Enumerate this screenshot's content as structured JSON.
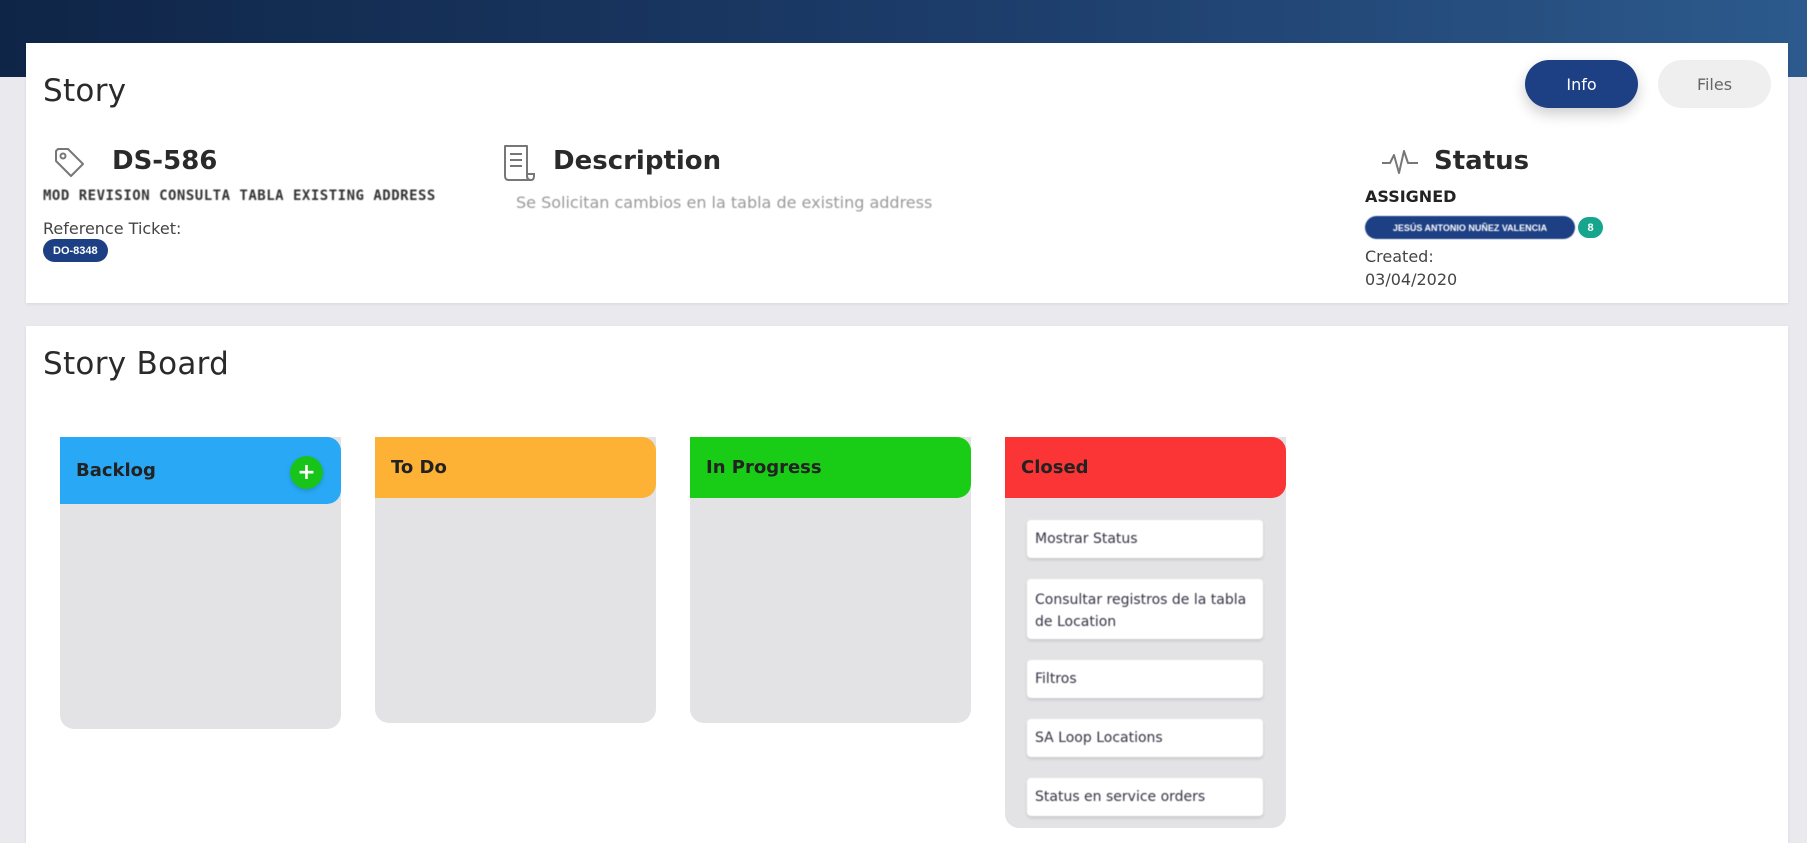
{
  "header": {
    "title": "Story",
    "tabs": [
      {
        "label": "Info",
        "active": true
      },
      {
        "label": "Files",
        "active": false
      }
    ]
  },
  "story": {
    "id": "DS-586",
    "subject": "MOD REVISION CONSULTA TABLA EXISTING ADDRESS",
    "reference_label": "Reference Ticket:",
    "reference_ticket": "DO-8348",
    "description_title": "Description",
    "description_text": "Se Solicitan cambios en la tabla de existing address",
    "status_title": "Status",
    "status_value": "ASSIGNED",
    "assignee": "JESÚS ANTONIO NUÑEZ VALENCIA",
    "assignee_count": "8",
    "created_label": "Created:",
    "created_date": "03/04/2020"
  },
  "board": {
    "title": "Story Board",
    "columns": [
      {
        "name": "Backlog",
        "color": "#29a8f5"
      },
      {
        "name": "To Do",
        "color": "#fdb135"
      },
      {
        "name": "In Progress",
        "color": "#19cc15"
      },
      {
        "name": "Closed",
        "color": "#fb3535"
      }
    ],
    "closed_tasks": [
      "Mostrar Status",
      "Consultar registros de la tabla de Location",
      "Filtros",
      "SA Loop Locations",
      "Status en service orders"
    ]
  },
  "colors": {
    "primary": "#1d3f83",
    "badge_teal": "#17a58e",
    "add_button": "#19c41a"
  },
  "icons": [
    "tag-icon",
    "document-icon",
    "pulse-icon",
    "plus-icon"
  ]
}
